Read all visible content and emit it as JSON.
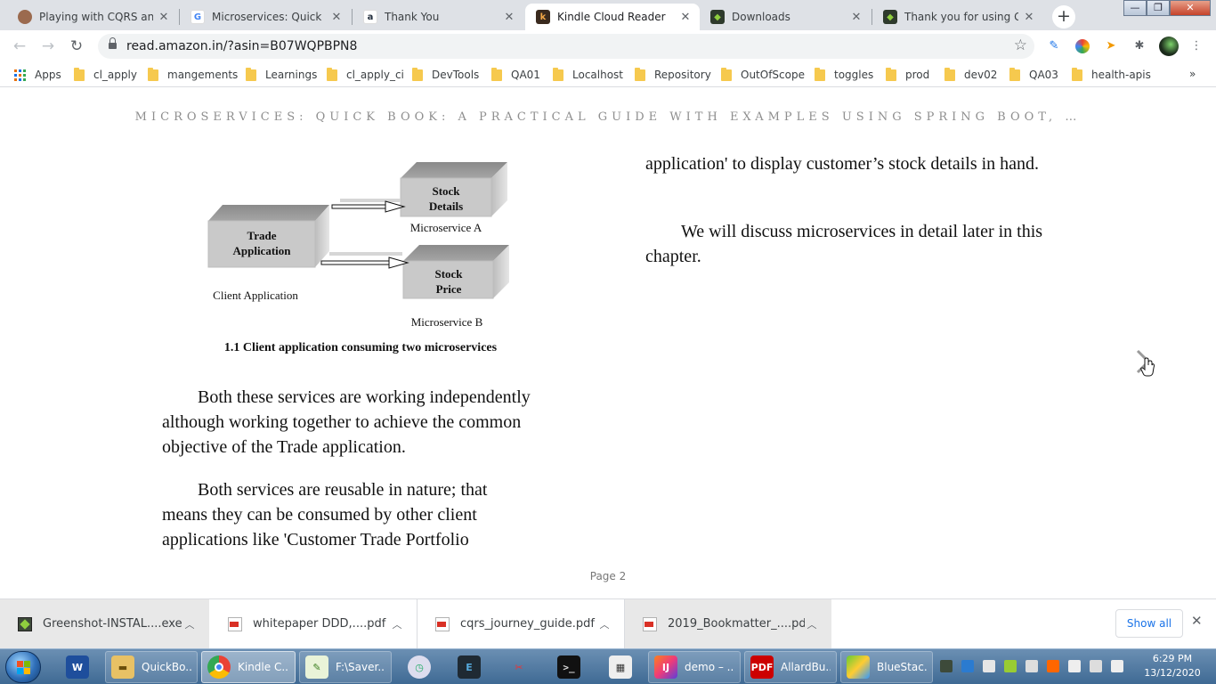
{
  "browser": {
    "tabs": [
      {
        "title": "Playing with CQRS and E",
        "favicon": "avatar-photo"
      },
      {
        "title": "Microservices: Quick Boo",
        "favicon": "google-g"
      },
      {
        "title": "Thank You",
        "favicon": "amazon-a"
      },
      {
        "title": "Kindle Cloud Reader",
        "favicon": "kindle-k",
        "active": true
      },
      {
        "title": "Downloads",
        "favicon": "greenshot"
      },
      {
        "title": "Thank you for using Gre",
        "favicon": "greenshot"
      }
    ],
    "new_tab_glyph": "+",
    "close_glyph": "✕",
    "window_controls": {
      "minimize": "—",
      "maximize": "❐",
      "close": "✕"
    },
    "url": "read.amazon.in/?asin=B07WQPBPN8",
    "bookmarks": {
      "apps_label": "Apps",
      "items": [
        "cl_apply",
        "mangements",
        "Learnings",
        "cl_apply_ci",
        "DevTools",
        "QA01",
        "Localhost",
        "Repository",
        "OutOfScope",
        "toggles",
        "prod",
        "dev02",
        "QA03",
        "health-apis"
      ],
      "more": "»"
    }
  },
  "reader": {
    "book_title": "MICROSERVICES: QUICK BOOK: A PRACTICAL GUIDE WITH EXAMPLES USING SPRING BOOT, …",
    "figure": {
      "client_box": {
        "line1": "Trade",
        "line2": "Application"
      },
      "client_label": "Client Application",
      "service_a": {
        "line1": "Stock",
        "line2": "Details",
        "label": "Microservice A"
      },
      "service_b": {
        "line1": "Stock",
        "line2": "Price",
        "label": "Microservice B"
      },
      "caption": "1.1 Client application consuming two microservices"
    },
    "left_paragraphs": [
      "Both these services are working independently although working together to achieve the common objective of the Trade application.",
      "Both services are reusable in nature; that means they can be consumed by other client applications like 'Customer Trade Portfolio"
    ],
    "right_paragraphs": [
      "application' to display customer’s stock details in hand.",
      "We will discuss microservices in detail later in this chapter."
    ],
    "page_label": "Page 2"
  },
  "downloads": {
    "items": [
      {
        "name": "Greenshot-INSTAL....exe",
        "icon": "greenshot-icon"
      },
      {
        "name": "whitepaper DDD,....pdf",
        "icon": "pdf-icon"
      },
      {
        "name": "cqrs_journey_guide.pdf",
        "icon": "pdf-icon"
      },
      {
        "name": "2019_Bookmatter_....pdf",
        "icon": "pdf-icon"
      }
    ],
    "show_all": "Show all",
    "close_glyph": "✕"
  },
  "taskbar": {
    "items": [
      {
        "label": "",
        "icon": "word-icon"
      },
      {
        "label": "QuickBo...",
        "icon": "folder-icon"
      },
      {
        "label": "Kindle C...",
        "icon": "chrome-icon",
        "active": true
      },
      {
        "label": "F:\\Saver...",
        "icon": "notepad-icon"
      },
      {
        "label": "",
        "icon": "clock-icon"
      },
      {
        "label": "",
        "icon": "editor-icon"
      },
      {
        "label": "",
        "icon": "snipping-icon"
      },
      {
        "label": "",
        "icon": "cmd-icon"
      },
      {
        "label": "",
        "icon": "calculator-icon"
      },
      {
        "label": "demo – ...",
        "icon": "intellij-icon"
      },
      {
        "label": "AllardBu...",
        "icon": "acrobat-icon"
      },
      {
        "label": "BlueStac...",
        "icon": "bluestacks-icon"
      }
    ],
    "time": "6:29 PM",
    "date": "13/12/2020"
  }
}
